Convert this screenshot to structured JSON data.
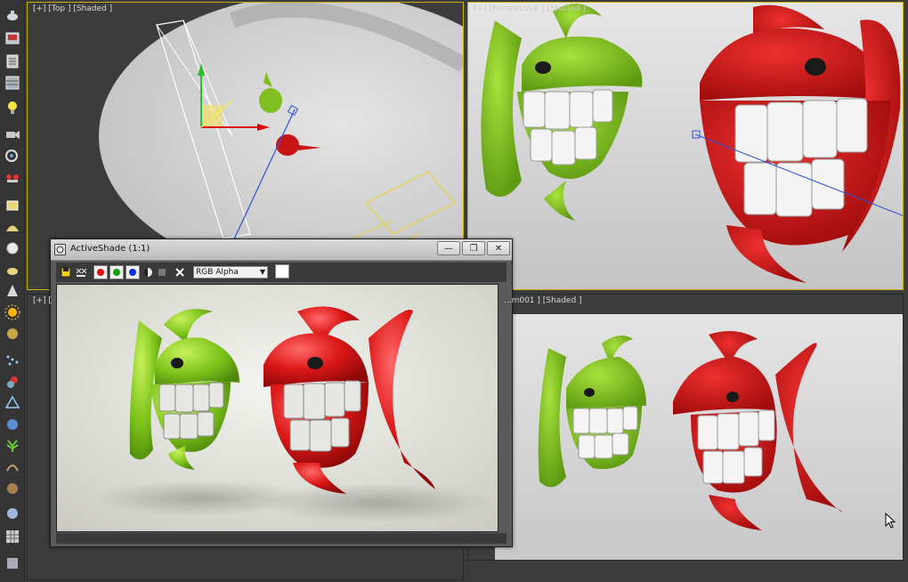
{
  "viewports": {
    "top_left": {
      "label": "[+] [Top ] [Shaded ]"
    },
    "top_right": {
      "label": "[+] [Perspective ] [Shaded ]"
    },
    "bottom_left": {
      "label": "[+] ["
    },
    "bottom_right": {
      "label": "...m001 ] [Shaded ]"
    }
  },
  "activeshade": {
    "title": "ActiveShade (1:1)",
    "channel_select": "RGB Alpha",
    "window_buttons": {
      "minimize": "—",
      "restore": "❐",
      "close": "✕"
    }
  },
  "toolbar_icons": [
    "teapot-icon",
    "render-setup-icon",
    "rendered-frame-icon",
    "material-editor-icon",
    "light-icon",
    "camera-icon",
    "helper-icon",
    "spacewarp-icon",
    "plane-icon",
    "dome-icon",
    "sphere-icon",
    "teapot-geo-icon",
    "cone-icon",
    "sun-icon",
    "globe-icon",
    "particles-icon",
    "shapes-icon",
    "compound-icon",
    "patch-icon",
    "foliage-icon",
    "hair-icon",
    "fur-icon",
    "ball-icon",
    "grid-icon",
    "scene-icon"
  ],
  "colors": {
    "green_fish": "#7fc21e",
    "red_fish": "#d01818",
    "active_border": "#c8b400",
    "viewport_bg": "#d4d4d4"
  }
}
